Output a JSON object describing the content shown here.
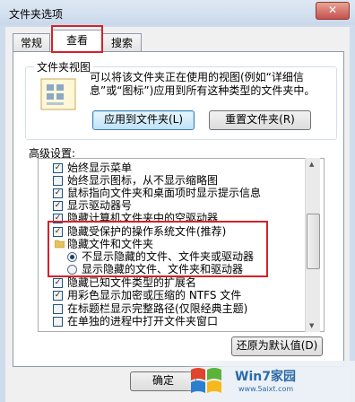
{
  "window": {
    "title": "文件夹选项",
    "close_label": "✕"
  },
  "tabs": [
    {
      "label": "常规",
      "active": false
    },
    {
      "label": "查看",
      "active": true
    },
    {
      "label": "搜索",
      "active": false
    }
  ],
  "folder_views": {
    "title": "文件夹视图",
    "description": "可以将该文件夹正在使用的视图(例如“详细信息”或“图标”)应用到所有这种类型的文件夹中。",
    "apply_button": "应用到文件夹(L)",
    "reset_button": "重置文件夹(R)"
  },
  "advanced": {
    "label": "高级设置:",
    "items": [
      {
        "type": "checkbox",
        "checked": true,
        "label": "始终显示菜单"
      },
      {
        "type": "checkbox",
        "checked": false,
        "label": "始终显示图标，从不显示缩略图"
      },
      {
        "type": "checkbox",
        "checked": true,
        "label": "鼠标指向文件夹和桌面项时显示提示信息"
      },
      {
        "type": "checkbox",
        "checked": true,
        "label": "显示驱动器号"
      },
      {
        "type": "checkbox",
        "checked": true,
        "label": "隐藏计算机文件夹中的空驱动器"
      },
      {
        "type": "checkbox",
        "checked": true,
        "label": "隐藏受保护的操作系统文件(推荐)"
      },
      {
        "type": "folder",
        "label": "隐藏文件和文件夹"
      },
      {
        "type": "radio",
        "checked": true,
        "label": "不显示隐藏的文件、文件夹或驱动器"
      },
      {
        "type": "radio",
        "checked": false,
        "label": "显示隐藏的文件、文件夹和驱动器"
      },
      {
        "type": "checkbox",
        "checked": true,
        "label": "隐藏已知文件类型的扩展名"
      },
      {
        "type": "checkbox",
        "checked": true,
        "label": "用彩色显示加密或压缩的 NTFS 文件"
      },
      {
        "type": "checkbox",
        "checked": false,
        "label": "在标题栏显示完整路径(仅限经典主题)"
      },
      {
        "type": "checkbox",
        "checked": false,
        "label": "在单独的进程中打开文件夹窗口"
      }
    ],
    "restore_button": "还原为默认值(D)"
  },
  "footer": {
    "ok_button": "确定"
  },
  "watermark": {
    "text": "Win7家园",
    "url": "www.5aixt.com"
  }
}
